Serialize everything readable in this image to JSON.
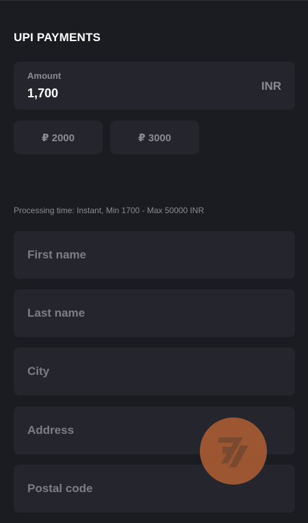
{
  "header": {
    "title": "UPI PAYMENTS"
  },
  "amount": {
    "label": "Amount",
    "value": "1,700",
    "currency": "INR"
  },
  "quick_amounts": [
    {
      "label": "₽ 2000"
    },
    {
      "label": "₽ 3000"
    }
  ],
  "processing_text": "Processing time: Instant, Min 1700 - Max 50000 INR",
  "form": {
    "first_name": {
      "placeholder": "First name",
      "value": ""
    },
    "last_name": {
      "placeholder": "Last name",
      "value": ""
    },
    "city": {
      "placeholder": "City",
      "value": ""
    },
    "address": {
      "placeholder": "Address",
      "value": ""
    },
    "postal_code": {
      "placeholder": "Postal code",
      "value": ""
    }
  },
  "fab": {
    "icon": "logo-icon",
    "color": "#b26034"
  },
  "colors": {
    "background": "#1b1c22",
    "field": "#25262d",
    "muted_text": "#8b8c93"
  }
}
